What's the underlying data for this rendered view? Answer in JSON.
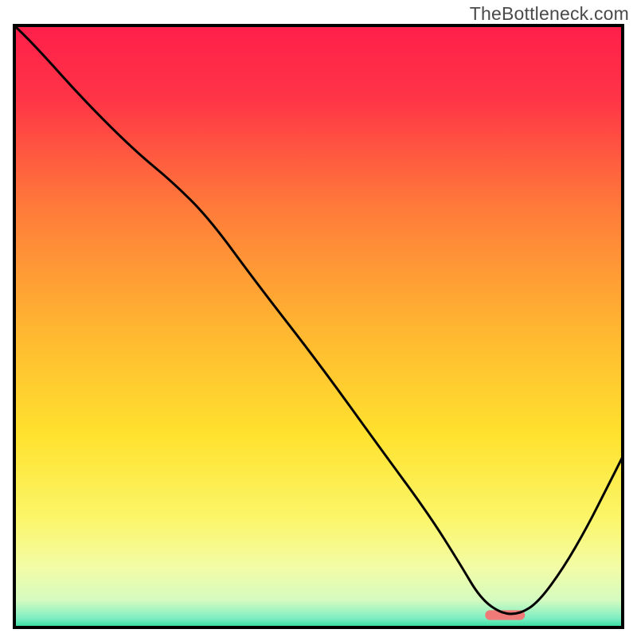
{
  "watermark": "TheBottleneck.com",
  "chart_data": {
    "type": "line",
    "title": "",
    "xlabel": "",
    "ylabel": "",
    "xlim": [
      0,
      100
    ],
    "ylim": [
      0,
      100
    ],
    "background_gradient": {
      "stops": [
        {
          "offset": 0.0,
          "color": "#ff1f4a"
        },
        {
          "offset": 0.12,
          "color": "#ff3447"
        },
        {
          "offset": 0.3,
          "color": "#ff7a3a"
        },
        {
          "offset": 0.5,
          "color": "#ffb531"
        },
        {
          "offset": 0.68,
          "color": "#ffe22e"
        },
        {
          "offset": 0.82,
          "color": "#fbf66a"
        },
        {
          "offset": 0.9,
          "color": "#f3fca6"
        },
        {
          "offset": 0.955,
          "color": "#d4fbc0"
        },
        {
          "offset": 0.985,
          "color": "#7eeec2"
        },
        {
          "offset": 1.0,
          "color": "#2fdc9e"
        }
      ]
    },
    "series": [
      {
        "name": "bottleneck-curve",
        "color": "#000000",
        "stroke_width": 3,
        "x": [
          0.0,
          4.0,
          12.0,
          20.0,
          26.0,
          32.0,
          40.0,
          50.0,
          60.0,
          68.0,
          73.0,
          76.5,
          80.0,
          83.0,
          86.0,
          90.0,
          94.0,
          97.0,
          100.0
        ],
        "y": [
          100.0,
          96.0,
          87.0,
          79.0,
          74.0,
          68.0,
          57.0,
          44.0,
          30.0,
          19.0,
          11.0,
          5.0,
          2.5,
          2.5,
          4.5,
          10.0,
          17.0,
          23.0,
          29.0
        ]
      }
    ],
    "highlight": {
      "name": "optimal-zone",
      "color": "#ef7a78",
      "x_center": 80.5,
      "y_center": 2.3,
      "width": 6.5,
      "height": 1.6
    },
    "axes": {
      "show_ticks": false,
      "frame_color": "#000000",
      "frame_width": 4
    }
  }
}
